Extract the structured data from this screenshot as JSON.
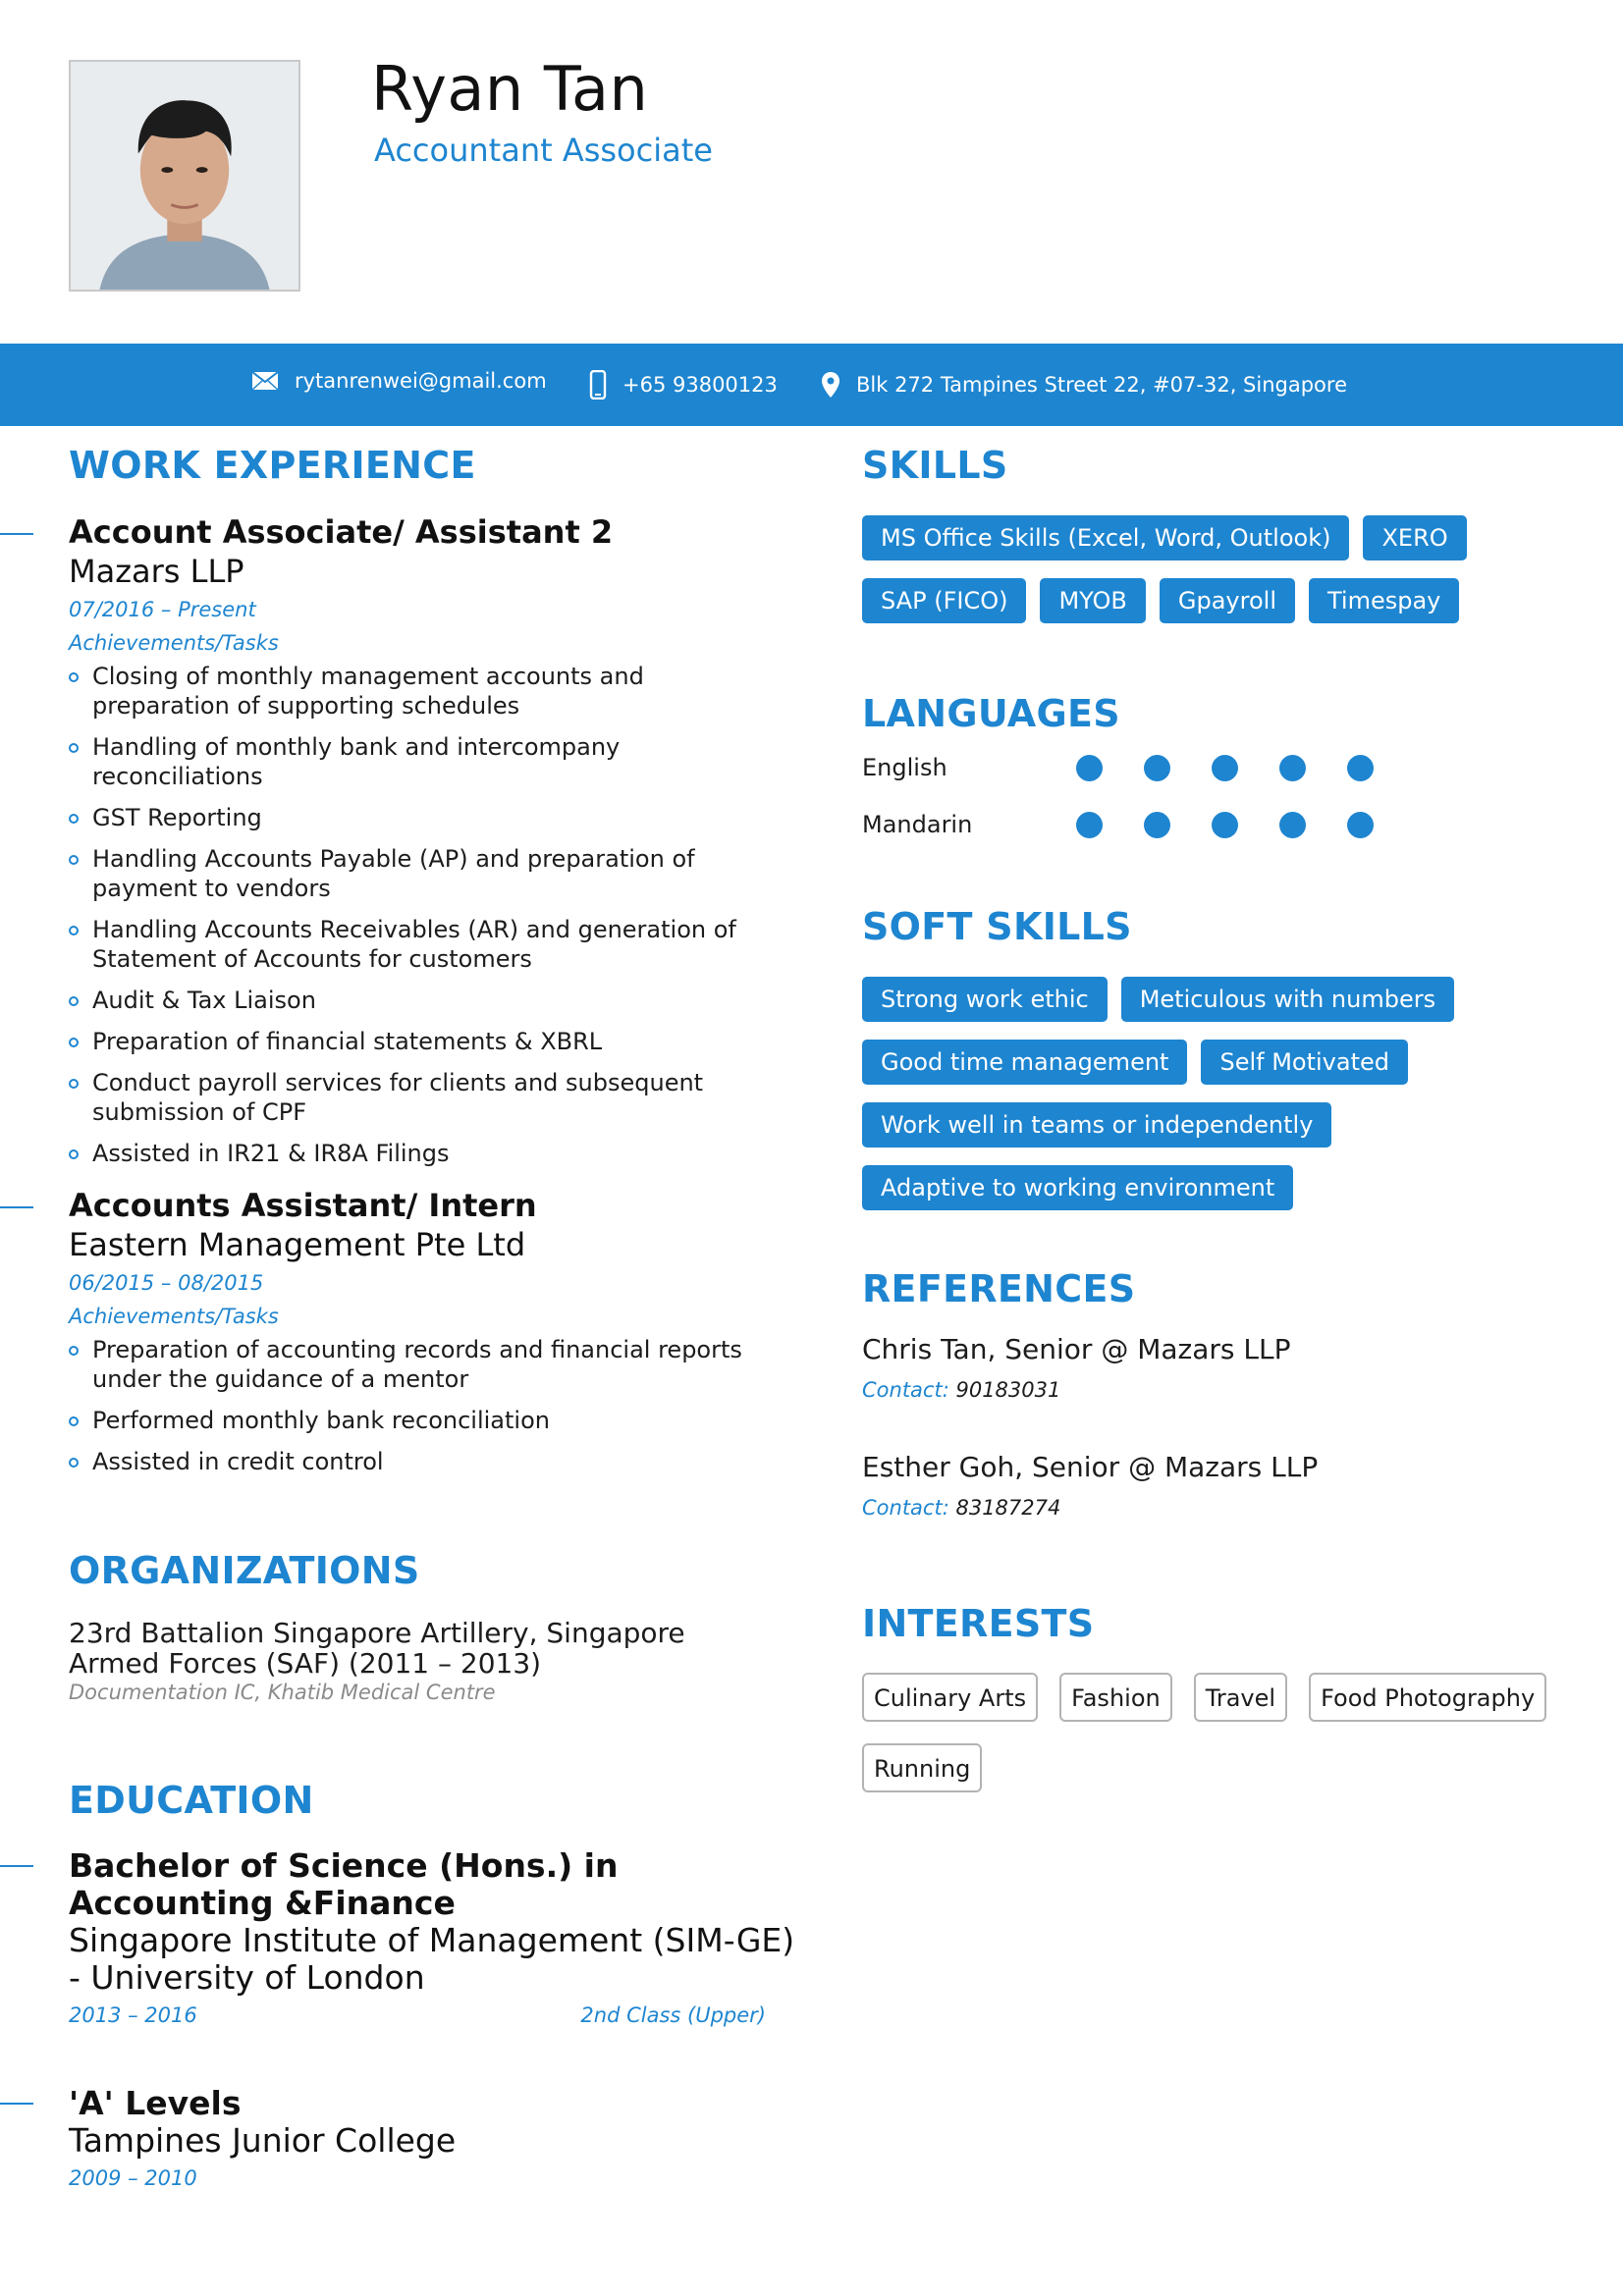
{
  "header": {
    "name": "Ryan Tan",
    "title": "Accountant Associate"
  },
  "contact": {
    "email": "rytanrenwei@gmail.com",
    "phone": "+65 93800123",
    "address": "Blk 272 Tampines Street 22, #07-32, Singapore",
    "icons": [
      "envelope-icon",
      "phone-icon",
      "location-pin-icon"
    ]
  },
  "work": {
    "heading": "WORK EXPERIENCE",
    "jobs": [
      {
        "title": "Account Associate/ Assistant 2",
        "company": "Mazars LLP",
        "date": "07/2016 – Present",
        "ach_label": "Achievements/Tasks",
        "tasks": [
          "Closing of monthly management accounts and preparation of supporting schedules",
          "Handling of monthly bank and intercompany reconciliations",
          "GST Reporting",
          "Handling Accounts Payable (AP) and preparation of payment to vendors",
          "Handling Accounts Receivables (AR) and generation of Statement of Accounts for customers",
          "Audit & Tax Liaison",
          "Preparation of financial statements & XBRL",
          "Conduct payroll services for clients and subsequent submission of CPF",
          "Assisted in IR21 & IR8A Filings"
        ]
      },
      {
        "title": "Accounts Assistant/ Intern",
        "company": "Eastern Management Pte Ltd",
        "date": "06/2015 – 08/2015",
        "ach_label": "Achievements/Tasks",
        "tasks": [
          "Preparation of accounting records and financial reports under the guidance of a mentor",
          "Performed monthly bank reconciliation",
          "Assisted in credit control"
        ]
      }
    ]
  },
  "organizations": {
    "heading": "ORGANIZATIONS",
    "name": "23rd Battalion Singapore Artillery, Singapore Armed Forces (SAF) (2011 – 2013)",
    "sub": "Documentation IC, Khatib Medical Centre"
  },
  "education": {
    "heading": "EDUCATION",
    "items": [
      {
        "title": "Bachelor of Science (Hons.) in Accounting &Finance",
        "school": "Singapore Institute of Management (SIM-GE) - University of London",
        "date": "2013 – 2016",
        "grade": "2nd Class (Upper)"
      },
      {
        "title": "'A' Levels",
        "school": "Tampines Junior College",
        "date": "2009 – 2010",
        "grade": ""
      }
    ]
  },
  "skills": {
    "heading": "SKILLS",
    "items": [
      "MS Office Skills (Excel, Word, Outlook)",
      "XERO",
      "SAP (FICO)",
      "MYOB",
      "Gpayroll",
      "Timespay"
    ]
  },
  "languages": {
    "heading": "LANGUAGES",
    "items": [
      {
        "name": "English",
        "level": 5,
        "max": 5
      },
      {
        "name": "Mandarin",
        "level": 5,
        "max": 5
      }
    ]
  },
  "soft_skills": {
    "heading": "SOFT SKILLS",
    "items": [
      "Strong work ethic",
      "Meticulous with numbers",
      "Good time management",
      "Self Motivated",
      "Work well in teams or independently",
      "Adaptive to working environment"
    ]
  },
  "references": {
    "heading": "REFERENCES",
    "items": [
      {
        "name": "Chris Tan, Senior @ Mazars LLP",
        "contact_label": "Contact:",
        "contact": "90183031"
      },
      {
        "name": "Esther Goh, Senior @ Mazars LLP",
        "contact_label": "Contact:",
        "contact": "83187274"
      }
    ]
  },
  "interests": {
    "heading": "INTERESTS",
    "items": [
      "Culinary Arts",
      "Fashion",
      "Travel",
      "Food Photography",
      "Running"
    ]
  },
  "colors": {
    "accent": "#1e85d0",
    "text": "#1c1c1c",
    "muted": "#8a8a8a"
  }
}
